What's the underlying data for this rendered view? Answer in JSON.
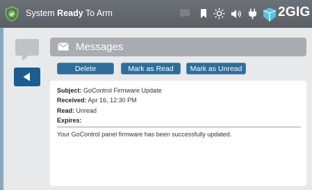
{
  "status": {
    "prefix": "System",
    "state": "Ready",
    "suffix": "To Arm"
  },
  "brand": {
    "logo_text": "2GIG"
  },
  "top_icons": [
    "message-icon",
    "bookmark-icon",
    "sun-icon",
    "speaker-icon",
    "plug-icon"
  ],
  "colors": {
    "accent": "#1b5e8d",
    "shield": "#6cc04a",
    "logo": "#5bc0de"
  },
  "header": {
    "title": "Messages"
  },
  "actions": {
    "delete_label": "Delete",
    "mark_read_label": "Mark as Read",
    "mark_unread_label": "Mark as Unread"
  },
  "message": {
    "subject_label": "Subject:",
    "subject": "GoControl Firmware Update",
    "received_label": "Received:",
    "received": "Apr 16, 12:30 PM",
    "read_label": "Read:",
    "read": "Unread",
    "expires_label": "Expires:",
    "expires": "",
    "body": "Your GoControl panel firmware has been successfully updated."
  }
}
